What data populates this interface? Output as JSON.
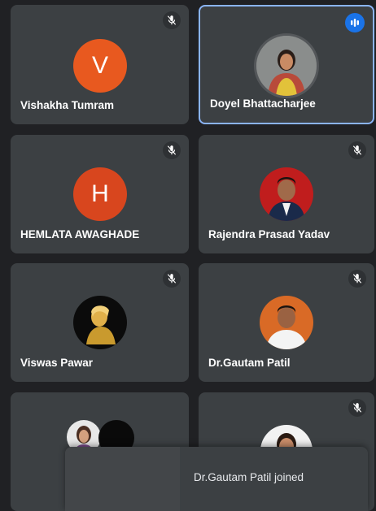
{
  "participants": [
    {
      "name": "Vishakha Tumram",
      "initial": "V",
      "avatar_color": "#e8591f",
      "muted": true
    },
    {
      "name": "Doyel Bhattacharjee",
      "speaking": true,
      "active": true
    },
    {
      "name": "HEMLATA AWAGHADE",
      "initial": "H",
      "avatar_color": "#d8461e",
      "muted": true
    },
    {
      "name": "Rajendra Prasad Yadav",
      "muted": true
    },
    {
      "name": "Viswas Pawar",
      "muted": true
    },
    {
      "name": "Dr.Gautam Patil",
      "muted": true
    },
    {
      "name": "",
      "muted": false
    },
    {
      "name": "",
      "muted": true
    }
  ],
  "notification": {
    "text": "Dr.Gautam Patil joined"
  },
  "icons": {
    "mute": "mic-off-icon",
    "speaking": "audio-level-icon"
  },
  "colors": {
    "active_border": "#8ab4f8",
    "speaking_badge": "#1a73e8",
    "tile_bg": "#3c4043"
  }
}
